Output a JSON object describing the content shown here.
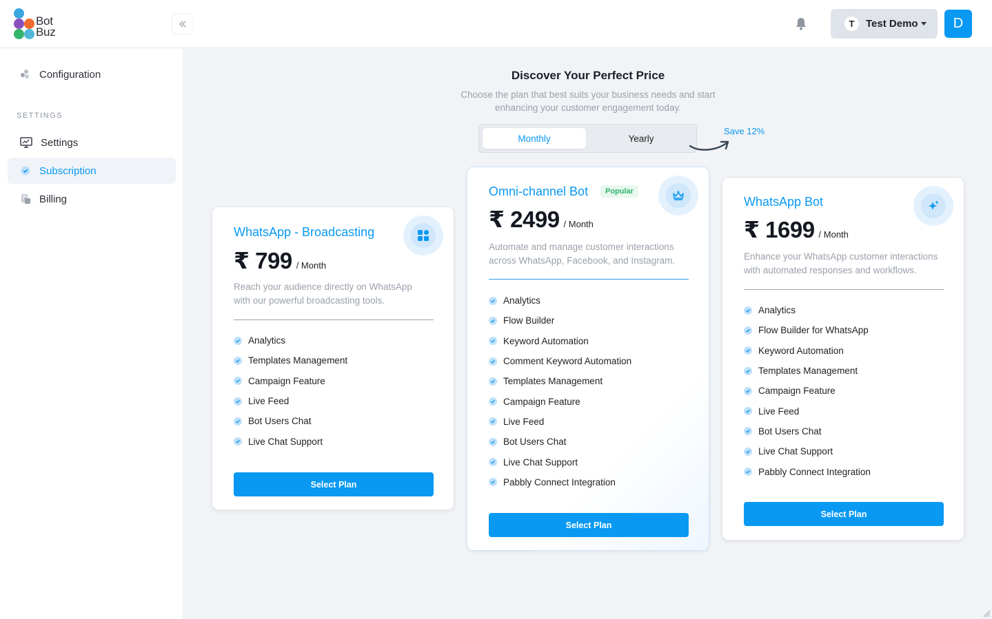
{
  "brand": {
    "line1": "Bot",
    "line2": "Buz"
  },
  "header": {
    "user_initial": "T",
    "user_name": "Test Demo",
    "avatar_letter": "D"
  },
  "sidebar": {
    "top_item": "Configuration",
    "section_label": "SETTINGS",
    "items": [
      {
        "label": "Settings"
      },
      {
        "label": "Subscription"
      },
      {
        "label": "Billing"
      }
    ]
  },
  "main": {
    "title": "Discover Your Perfect Price",
    "subtitle_line1": "Choose the plan that best suits your business needs and start",
    "subtitle_line2": "enhancing your customer engagement today.",
    "toggle": {
      "monthly": "Monthly",
      "yearly": "Yearly",
      "selected": "Monthly"
    },
    "save_note": "Save 12%"
  },
  "colors": {
    "accent": "#0a99f2",
    "popular_badge": "#2fb56a"
  },
  "plans": [
    {
      "title": "WhatsApp - Broadcasting",
      "price": "₹ 799",
      "period": "/ Month",
      "desc_line1": "Reach your audience directly on WhatsApp",
      "desc_line2": "with our powerful broadcasting tools.",
      "icon": "grid-icon",
      "features": [
        "Analytics",
        "Templates Management",
        "Campaign Feature",
        "Live Feed",
        "Bot Users Chat",
        "Live Chat Support"
      ],
      "button": "Select Plan"
    },
    {
      "title": "Omni-channel Bot",
      "badge": "Popular",
      "price": "₹ 2499",
      "period": "/ Month",
      "desc_line1": "Automate and manage customer interactions",
      "desc_line2": "across WhatsApp, Facebook, and Instagram.",
      "icon": "crown-icon",
      "features": [
        "Analytics",
        "Flow Builder",
        "Keyword Automation",
        "Comment Keyword Automation",
        "Templates Management",
        "Campaign Feature",
        "Live Feed",
        "Bot Users Chat",
        "Live Chat Support",
        "Pabbly Connect Integration"
      ],
      "button": "Select Plan"
    },
    {
      "title": "WhatsApp Bot",
      "price": "₹ 1699",
      "period": "/ Month",
      "desc_line1": "Enhance your WhatsApp customer interactions",
      "desc_line2": "with automated responses and workflows.",
      "icon": "sparkle-icon",
      "features": [
        "Analytics",
        "Flow Builder for WhatsApp",
        "Keyword Automation",
        "Templates Management",
        "Campaign Feature",
        "Live Feed",
        "Bot Users Chat",
        "Live Chat Support",
        "Pabbly Connect Integration"
      ],
      "button": "Select Plan"
    }
  ]
}
